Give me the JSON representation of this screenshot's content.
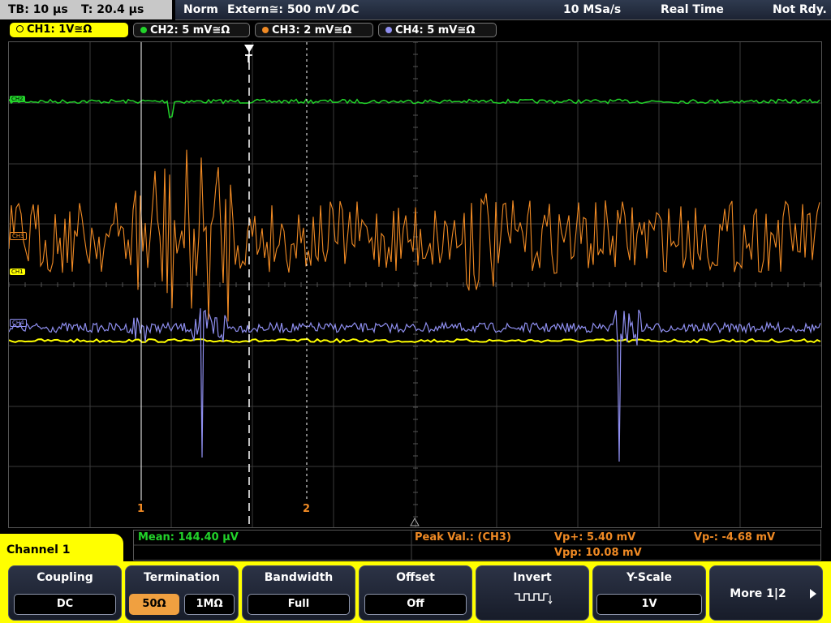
{
  "status": {
    "timebase": "TB: 10 µs",
    "trigger_time": "T: 20.4 µs",
    "mode": "Norm",
    "trigger": "Extern≅: 500 mV ⁄DC",
    "sample_rate": "10 MSa/s",
    "acq": "Real Time",
    "ready": "Not Rdy."
  },
  "channels": [
    {
      "label": "CH1: 1V≅Ω",
      "color": "#ffff00"
    },
    {
      "label": "CH2: 5 mV≅Ω",
      "color": "#22d32a"
    },
    {
      "label": "CH3: 2 mV≅Ω",
      "color": "#f08a24"
    },
    {
      "label": "CH4: 5 mV≅Ω",
      "color": "#8f8ff0"
    }
  ],
  "markers": {
    "trigger": "T",
    "cursor1": "1",
    "cursor2": "2",
    "ch2_tag": "CH2",
    "ch3_tag": "CH3",
    "ch1_tag": "CH1",
    "ch4_tag": "CH4"
  },
  "readout": {
    "mean": "Mean: 144.40 µV",
    "peak_label": "Peak Val.: (CH3)",
    "vp_plus": "Vp+: 5.40 mV",
    "vp_minus": "Vp-: -4.68 mV",
    "vpp": "Vpp: 10.08 mV"
  },
  "menu": {
    "channel": "Channel 1",
    "coupling": {
      "title": "Coupling",
      "value": "DC"
    },
    "termination": {
      "title": "Termination",
      "opt1": "50Ω",
      "opt2": "1MΩ"
    },
    "bandwidth": {
      "title": "Bandwidth",
      "value": "Full"
    },
    "offset": {
      "title": "Offset",
      "value": "Off"
    },
    "invert": {
      "title": "Invert"
    },
    "yscale": {
      "title": "Y-Scale",
      "value": "1V"
    },
    "more": "More 1|2"
  }
}
